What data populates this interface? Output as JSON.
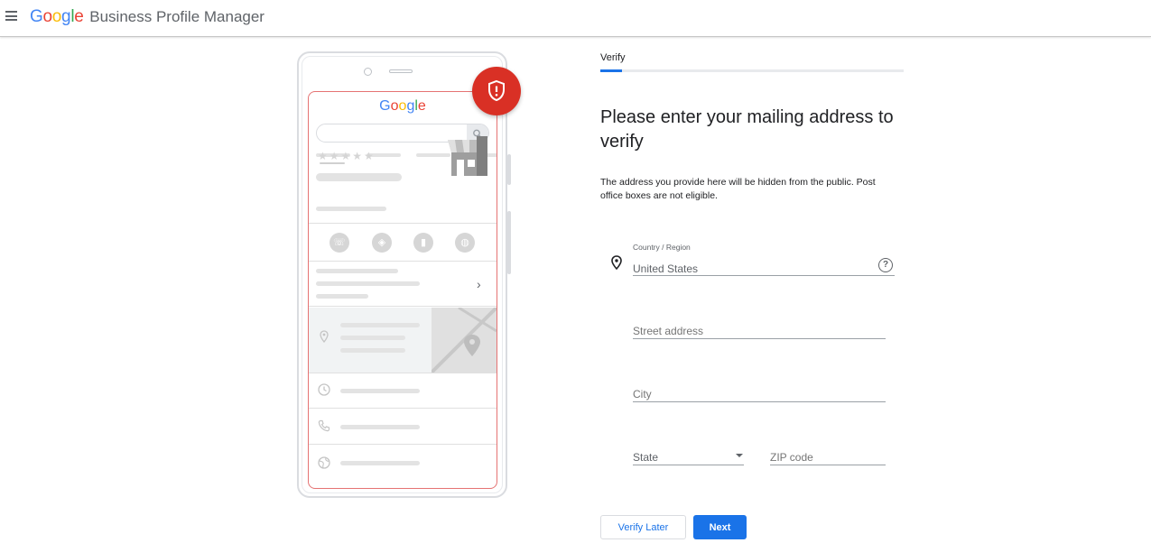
{
  "header": {
    "brand_google_letters": [
      "G",
      "o",
      "o",
      "g",
      "l",
      "e"
    ],
    "product_name": "Business Profile Manager"
  },
  "illustration": {
    "logo_letters": [
      "G",
      "o",
      "o",
      "g",
      "l",
      "e"
    ],
    "rating_stars": "★★★★★"
  },
  "stepper": {
    "current_step": "Verify",
    "progress_fraction": 0.07
  },
  "form": {
    "heading": "Please enter your mailing address to verify",
    "description": "The address you provide here will be hidden from the public. Post office boxes are not eligible.",
    "country_label": "Country / Region",
    "country_value": "United States",
    "street_placeholder": "Street address",
    "city_placeholder": "City",
    "state_placeholder": "State",
    "zip_placeholder": "ZIP code"
  },
  "buttons": {
    "verify_later": "Verify Later",
    "next": "Next"
  },
  "colors": {
    "accent": "#1a73e8",
    "badge_red": "#d93025",
    "screen_outline": "#e57373"
  }
}
